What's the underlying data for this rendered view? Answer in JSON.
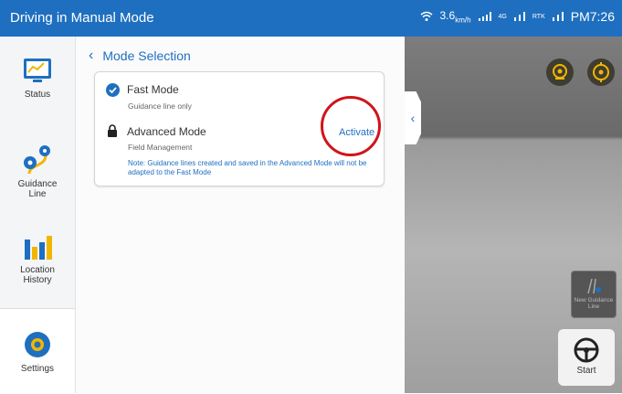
{
  "topbar": {
    "title": "Driving in Manual Mode",
    "speed_value": "3.6",
    "speed_unit": "km/h",
    "signal_4g": "4G",
    "rtk_label": "RTK",
    "time": "PM7:26"
  },
  "sidebar": {
    "items": [
      {
        "label": "Status"
      },
      {
        "label": "Guidance Line"
      },
      {
        "label": "Location History"
      },
      {
        "label": "Settings"
      }
    ]
  },
  "panel": {
    "title": "Mode Selection",
    "fast": {
      "title": "Fast Mode",
      "subtitle": "Guidance line only"
    },
    "advanced": {
      "title": "Advanced Mode",
      "subtitle": "Field Management",
      "action": "Activate",
      "note": "Note: Guidance lines created and saved in the Advanced Mode will not be adapted to the Fast Mode"
    }
  },
  "view": {
    "new_guidance_label": "New Guidance Line",
    "start_label": "Start"
  },
  "colors": {
    "primary": "#1f6fc0",
    "highlight": "#d0141a",
    "gold": "#f2b600"
  }
}
